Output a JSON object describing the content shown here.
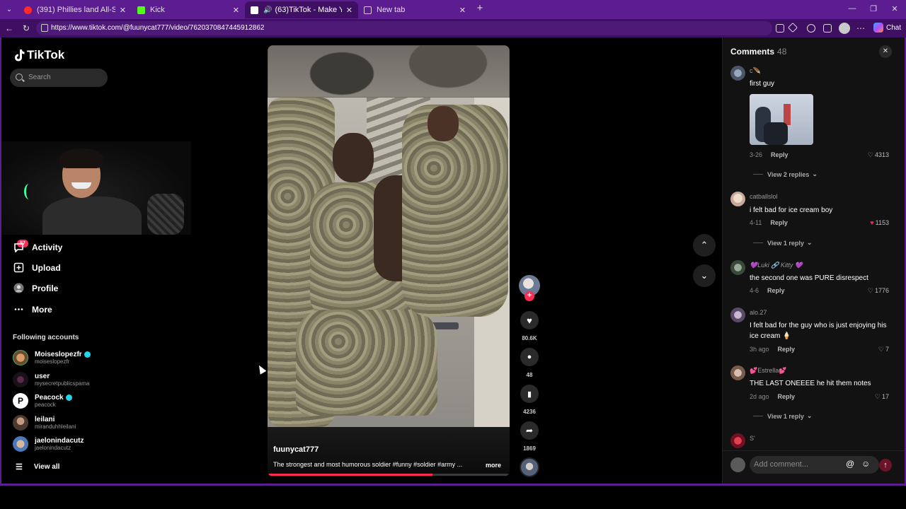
{
  "browser": {
    "tabs": [
      {
        "title": "(391) Phillies land All-Star closer J...",
        "fav_color": "#ff2a2a"
      },
      {
        "title": "Kick",
        "fav_color": "#53fc18"
      },
      {
        "title": "(63)TikTok - Make Your Day",
        "fav_color": "#ffffff"
      },
      {
        "title": "New tab",
        "fav_color": "#cfcfcf"
      }
    ],
    "url": "https://www.tiktok.com/@fuunycat777/video/7620370847445912862",
    "chat_label": "Chat",
    "icons": [
      "tab-list-icon",
      "back-icon",
      "refresh-icon",
      "plus-icon",
      "minimize-icon",
      "maximize-icon",
      "close-icon"
    ]
  },
  "sidebar": {
    "logo": "TikTok",
    "search_placeholder": "Search",
    "activity_badge": "57",
    "nav": [
      {
        "label": "Activity",
        "icon": "activity-icon"
      },
      {
        "label": "Upload",
        "icon": "upload-icon"
      },
      {
        "label": "Profile",
        "icon": "profile-icon"
      },
      {
        "label": "More",
        "icon": "more-icon"
      }
    ],
    "following_title": "Following accounts",
    "following": [
      {
        "name": "Moiseslopezfr",
        "handle": "moiseslopezfr",
        "verified": true,
        "avatar_color": "#c87a4a"
      },
      {
        "name": "user",
        "handle": "mysecretpublicspama",
        "verified": false,
        "avatar_color": "#2a1b2a"
      },
      {
        "name": "Peacock",
        "handle": "peacock",
        "verified": true,
        "avatar_color": "#ffffff"
      },
      {
        "name": "leilani",
        "handle": "miranduhhleilani",
        "verified": false,
        "avatar_color": "#8a6a5a"
      },
      {
        "name": "jaelonindacutz",
        "handle": "jaelonindacutz",
        "verified": false,
        "avatar_color": "#4a7ab8"
      }
    ],
    "view_all": "View all"
  },
  "video": {
    "username": "fuunycat777",
    "description": "The strongest and most humorous soldier #funny #soldier #army ...",
    "more_label": "more",
    "progress": 0.68
  },
  "actions": {
    "likes": "80.6K",
    "comments": "48",
    "saves": "4236",
    "shares": "1869"
  },
  "comments": {
    "title": "Comments",
    "count": "48",
    "add_placeholder": "Add comment...",
    "items": [
      {
        "user": "c🪶",
        "text": "first guy",
        "date": "3-26",
        "likes": "4313",
        "liked": false,
        "replies": "View 2 replies",
        "avatar_color": "#7a8aa0",
        "has_image": true
      },
      {
        "user": "catballslol",
        "text": "i felt bad for ice cream boy",
        "date": "4-11",
        "likes": "1153",
        "liked": true,
        "replies": "View 1 reply",
        "avatar_color": "#e8d8c8"
      },
      {
        "user": "💜Luki 🔗 Kitty 💜",
        "text": "the second one was PURE disrespect",
        "date": "4-6",
        "likes": "1776",
        "liked": false,
        "replies": "",
        "avatar_color": "#6a7a6a"
      },
      {
        "user": "alo.27",
        "text": "I felt bad for the guy who is just enjoying his ice cream 🍦",
        "date": "3h ago",
        "likes": "7",
        "liked": false,
        "replies": "",
        "avatar_color": "#9a8aa0"
      },
      {
        "user": "💕Estrella💕",
        "text": "THE LAST ONEEEE he hit them notes",
        "date": "2d ago",
        "likes": "17",
        "liked": false,
        "replies": "View 1 reply",
        "avatar_color": "#a08070"
      },
      {
        "user": "S'",
        "text": "",
        "date": "",
        "likes": "",
        "liked": false,
        "replies": "",
        "avatar_color": "#c02030"
      }
    ],
    "reply_label": "Reply"
  }
}
